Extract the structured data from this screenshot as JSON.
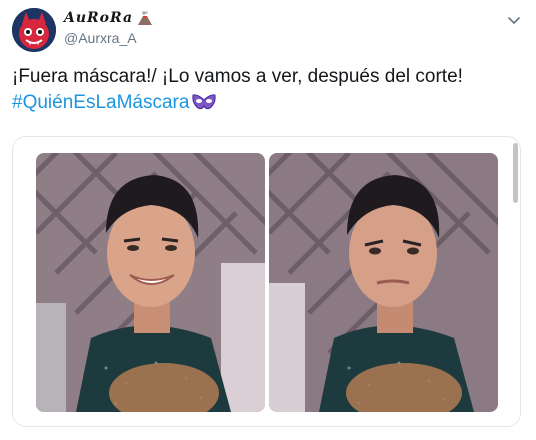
{
  "tweet": {
    "display_name": "AuRoRa",
    "handle": "@Aurxra_A",
    "text": "¡Fuera máscara!/ ¡Lo vamos a ver, después del corte!",
    "hashtag": "#QuiénEsLaMáscara"
  },
  "icons": {
    "menu": "chevron-down-icon",
    "name_emoji": "volcano-icon",
    "hashtag_emoji": "mask-icon"
  },
  "colors": {
    "text": "#14171a",
    "muted": "#657786",
    "link": "#1b95e0",
    "border": "#e1e8ed"
  }
}
